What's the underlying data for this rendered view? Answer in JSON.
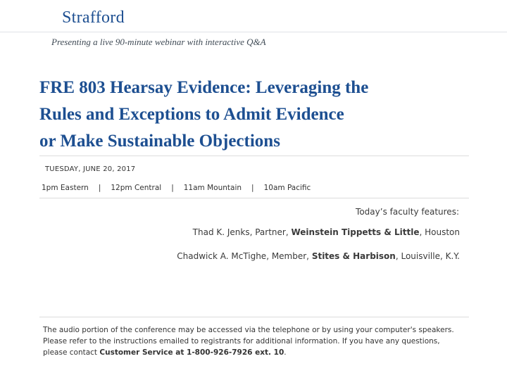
{
  "header": {
    "logo_text": "Strafford",
    "tagline": "Presenting a live 90-minute webinar with interactive Q&A"
  },
  "title_lines": [
    "FRE 803 Hearsay Evidence: Leveraging the",
    "Rules and Exceptions to Admit Evidence",
    "or Make Sustainable Objections"
  ],
  "date": "TUESDAY, JUNE 20, 2017",
  "times": {
    "eastern": "1pm Eastern",
    "central": "12pm Central",
    "mountain": "11am Mountain",
    "pacific": "10am Pacific",
    "separator": "|"
  },
  "faculty": {
    "heading": "Today’s faculty features:",
    "speakers": [
      {
        "prefix": "Thad K. Jenks, Partner, ",
        "firm": "Weinstein Tippetts & Little",
        "suffix": ", Houston"
      },
      {
        "prefix": "Chadwick A. McTighe, Member, ",
        "firm": "Stites & Harbison",
        "suffix": ", Louisville, K.Y."
      }
    ]
  },
  "notice": {
    "text": "The audio portion of the conference may be accessed via the telephone or by using your computer's speakers. Please refer to the instructions emailed to registrants for additional information.  If you have any questions, please contact ",
    "contact": "Customer Service at 1-800-926-7926 ext. 10",
    "end": "."
  }
}
